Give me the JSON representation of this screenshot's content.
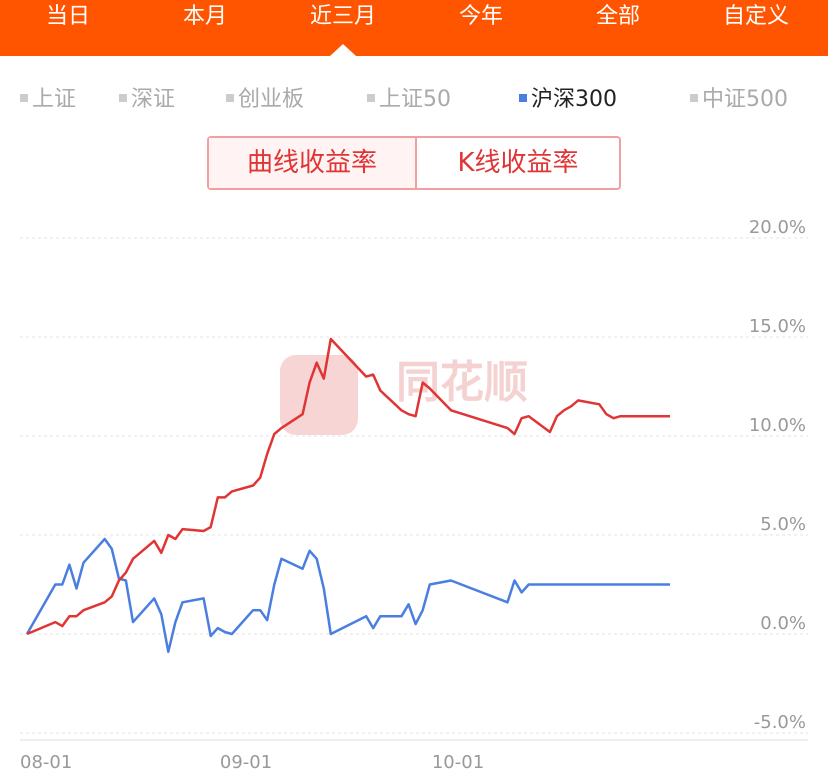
{
  "tabs": [
    "当日",
    "本月",
    "近三月",
    "今年",
    "全部",
    "自定义"
  ],
  "indices": [
    "上证",
    "深证",
    "创业板",
    "上证50",
    "沪深300",
    "中证500"
  ],
  "active_index": "沪深300",
  "toggle": {
    "curve_label": "曲线收益率",
    "kline_label": "K线收益率"
  },
  "watermark": "同花顺",
  "colors": {
    "header": "#ff5500",
    "portfolio_line": "#e03535",
    "index_line": "#4a7fe0",
    "active_marker": "#4a7fe0"
  },
  "chart_data": {
    "type": "line",
    "y_unit": "%",
    "ylim": [
      -5,
      20
    ],
    "y_ticks": [
      "20.0%",
      "15.0%",
      "10.0%",
      "5.0%",
      "0.0%",
      "-5.0%"
    ],
    "y_tick_values": [
      20,
      15,
      10,
      5,
      0,
      -5
    ],
    "x_tick_labels": [
      "08-01",
      "09-01",
      "10-01"
    ],
    "grid": true,
    "series": [
      {
        "color": "#e03535",
        "x": [
          "2024-08-01",
          "2024-08-05",
          "2024-08-06",
          "2024-08-07",
          "2024-08-08",
          "2024-08-09",
          "2024-08-12",
          "2024-08-13",
          "2024-08-14",
          "2024-08-15",
          "2024-08-16",
          "2024-08-19",
          "2024-08-20",
          "2024-08-21",
          "2024-08-22",
          "2024-08-23",
          "2024-08-26",
          "2024-08-27",
          "2024-08-28",
          "2024-08-29",
          "2024-08-30",
          "2024-09-02",
          "2024-09-03",
          "2024-09-04",
          "2024-09-05",
          "2024-09-06",
          "2024-09-09",
          "2024-09-10",
          "2024-09-11",
          "2024-09-12",
          "2024-09-13",
          "2024-09-18",
          "2024-09-19",
          "2024-09-20",
          "2024-09-23",
          "2024-09-24",
          "2024-09-25",
          "2024-09-26",
          "2024-09-27",
          "2024-09-30",
          "2024-10-08",
          "2024-10-09",
          "2024-10-10",
          "2024-10-11",
          "2024-10-14",
          "2024-10-15",
          "2024-10-16",
          "2024-10-17",
          "2024-10-18",
          "2024-10-21",
          "2024-10-22",
          "2024-10-23",
          "2024-10-24",
          "2024-10-25",
          "2024-10-28",
          "2024-10-29",
          "2024-10-30",
          "2024-10-31"
        ],
        "values": [
          0.0,
          0.6,
          0.4,
          0.9,
          0.9,
          1.2,
          1.6,
          1.9,
          2.7,
          3.1,
          3.8,
          4.7,
          4.1,
          5.0,
          4.8,
          5.3,
          5.2,
          5.4,
          6.9,
          6.9,
          7.2,
          7.5,
          7.9,
          9.1,
          10.1,
          10.4,
          11.1,
          12.7,
          13.7,
          12.9,
          14.9,
          13.0,
          13.1,
          12.3,
          11.3,
          11.1,
          11.0,
          12.7,
          12.4,
          11.3,
          10.4,
          10.1,
          10.9,
          11.0,
          10.2,
          11.0,
          11.3,
          11.5,
          11.8,
          11.6,
          11.1,
          10.9,
          11.0,
          11.0,
          11.0,
          11.0,
          11.0,
          11.0
        ]
      },
      {
        "name": "沪深300",
        "color": "#4a7fe0",
        "x": [
          "2024-08-01",
          "2024-08-05",
          "2024-08-06",
          "2024-08-07",
          "2024-08-08",
          "2024-08-09",
          "2024-08-12",
          "2024-08-13",
          "2024-08-14",
          "2024-08-15",
          "2024-08-16",
          "2024-08-19",
          "2024-08-20",
          "2024-08-21",
          "2024-08-22",
          "2024-08-23",
          "2024-08-26",
          "2024-08-27",
          "2024-08-28",
          "2024-08-29",
          "2024-08-30",
          "2024-09-02",
          "2024-09-03",
          "2024-09-04",
          "2024-09-05",
          "2024-09-06",
          "2024-09-09",
          "2024-09-10",
          "2024-09-11",
          "2024-09-12",
          "2024-09-13",
          "2024-09-18",
          "2024-09-19",
          "2024-09-20",
          "2024-09-23",
          "2024-09-24",
          "2024-09-25",
          "2024-09-26",
          "2024-09-27",
          "2024-09-30",
          "2024-10-08",
          "2024-10-09",
          "2024-10-10",
          "2024-10-11",
          "2024-10-14",
          "2024-10-15",
          "2024-10-16",
          "2024-10-17",
          "2024-10-18",
          "2024-10-21",
          "2024-10-22",
          "2024-10-23",
          "2024-10-24",
          "2024-10-25",
          "2024-10-28",
          "2024-10-29",
          "2024-10-30",
          "2024-10-31"
        ],
        "values": [
          0.0,
          2.5,
          2.5,
          3.5,
          2.3,
          3.6,
          4.8,
          4.3,
          2.8,
          2.7,
          0.6,
          1.8,
          1.0,
          -0.9,
          0.6,
          1.6,
          1.8,
          -0.1,
          0.3,
          0.1,
          0.0,
          1.2,
          1.2,
          0.7,
          2.5,
          3.8,
          3.3,
          4.2,
          3.8,
          2.3,
          0.0,
          0.9,
          0.3,
          0.9,
          0.9,
          1.5,
          0.5,
          1.2,
          2.5,
          2.7,
          1.6,
          2.7,
          2.1,
          2.5,
          2.5,
          2.5,
          2.5,
          2.5,
          2.5,
          2.5,
          2.5,
          2.5,
          2.5,
          2.5,
          2.5,
          2.5,
          2.5,
          2.5
        ]
      }
    ]
  }
}
